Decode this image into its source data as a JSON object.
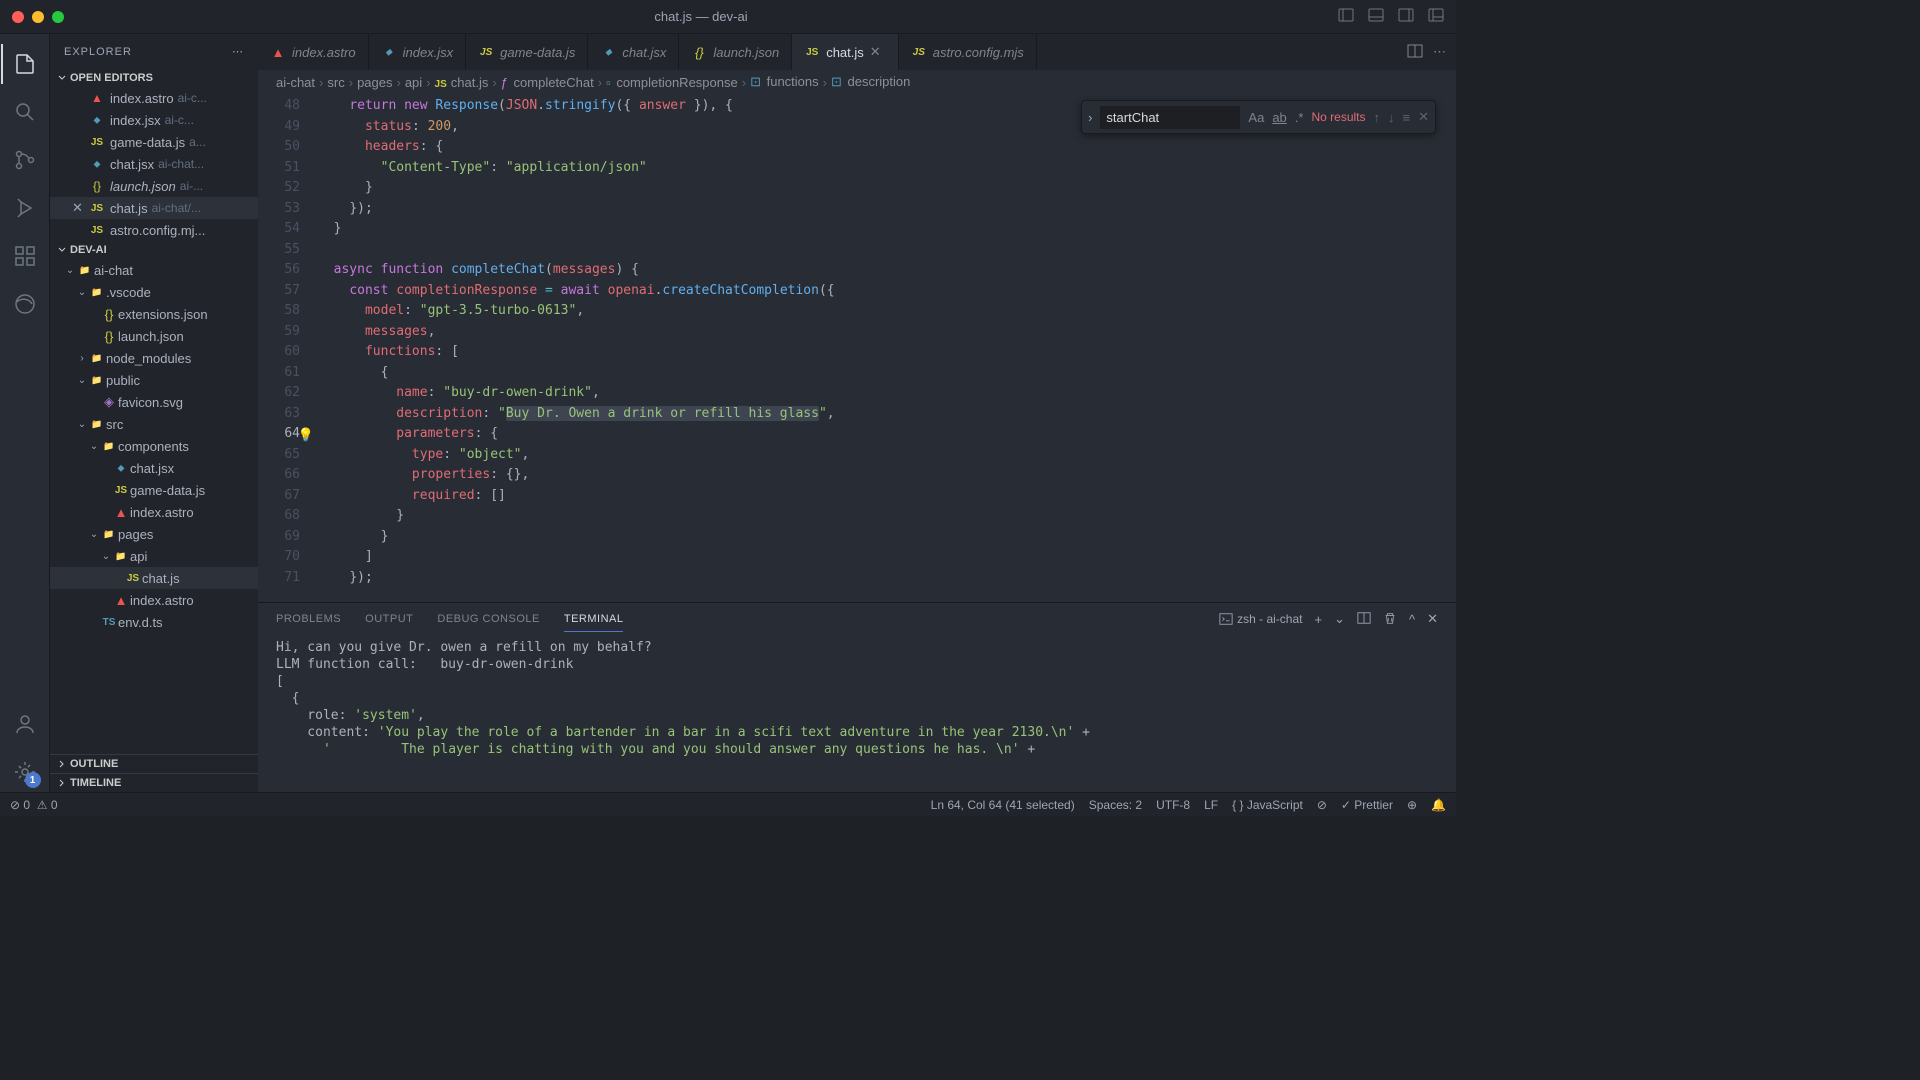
{
  "window": {
    "title": "chat.js — dev-ai"
  },
  "sidebar": {
    "header": "EXPLORER",
    "sections": {
      "openEditors": "OPEN EDITORS",
      "project": "DEV-AI",
      "outline": "OUTLINE",
      "timeline": "TIMELINE"
    },
    "openEditors": [
      {
        "label": "index.astro",
        "path": "ai-c..."
      },
      {
        "label": "index.jsx",
        "path": "ai-c..."
      },
      {
        "label": "game-data.js",
        "path": "a..."
      },
      {
        "label": "chat.jsx",
        "path": "ai-chat..."
      },
      {
        "label": "launch.json",
        "path": "ai-...",
        "italic": true
      },
      {
        "label": "chat.js",
        "path": "ai-chat/...",
        "active": true
      },
      {
        "label": "astro.config.mj...",
        "path": ""
      }
    ],
    "tree": [
      {
        "depth": 0,
        "chev": "down",
        "type": "folder",
        "label": "ai-chat"
      },
      {
        "depth": 1,
        "chev": "down",
        "type": "folder",
        "label": ".vscode"
      },
      {
        "depth": 2,
        "type": "json",
        "label": "extensions.json"
      },
      {
        "depth": 2,
        "type": "json",
        "label": "launch.json"
      },
      {
        "depth": 1,
        "chev": "right",
        "type": "folder",
        "label": "node_modules"
      },
      {
        "depth": 1,
        "chev": "down",
        "type": "folder",
        "label": "public"
      },
      {
        "depth": 2,
        "type": "svg",
        "label": "favicon.svg"
      },
      {
        "depth": 1,
        "chev": "down",
        "type": "folder",
        "label": "src"
      },
      {
        "depth": 2,
        "chev": "down",
        "type": "folder",
        "label": "components"
      },
      {
        "depth": 3,
        "type": "jsx",
        "label": "chat.jsx"
      },
      {
        "depth": 3,
        "type": "js",
        "label": "game-data.js"
      },
      {
        "depth": 3,
        "type": "astro",
        "label": "index.astro"
      },
      {
        "depth": 2,
        "chev": "down",
        "type": "folder",
        "label": "pages"
      },
      {
        "depth": 3,
        "chev": "down",
        "type": "folder",
        "label": "api"
      },
      {
        "depth": 4,
        "type": "js",
        "label": "chat.js",
        "sel": true
      },
      {
        "depth": 3,
        "type": "astro",
        "label": "index.astro"
      },
      {
        "depth": 2,
        "type": "ts",
        "label": "env.d.ts"
      }
    ]
  },
  "tabs": [
    {
      "label": "index.astro",
      "type": "astro"
    },
    {
      "label": "index.jsx",
      "type": "jsx"
    },
    {
      "label": "game-data.js",
      "type": "js"
    },
    {
      "label": "chat.jsx",
      "type": "jsx"
    },
    {
      "label": "launch.json",
      "type": "json",
      "italic": true
    },
    {
      "label": "chat.js",
      "type": "js",
      "active": true
    },
    {
      "label": "astro.config.mjs",
      "type": "js"
    }
  ],
  "breadcrumb": [
    "ai-chat",
    "src",
    "pages",
    "api",
    "chat.js",
    "completeChat",
    "completionResponse",
    "functions",
    "description"
  ],
  "find": {
    "value": "startChat",
    "results": "No results"
  },
  "code": {
    "startLine": 48,
    "lines": [
      "    <span class='k'>return</span> <span class='k'>new</span> <span class='fn'>Response</span><span class='p'>(</span><span class='v'>JSON</span><span class='p'>.</span><span class='fn'>stringify</span><span class='p'>({ </span><span class='v'>answer</span><span class='p'> }), {</span>",
      "      <span class='pr'>status</span><span class='p'>: </span><span class='c'>200</span><span class='p'>,</span>",
      "      <span class='pr'>headers</span><span class='p'>: {</span>",
      "        <span class='s'>\"Content-Type\"</span><span class='p'>: </span><span class='s'>\"application/json\"</span>",
      "      <span class='p'>}</span>",
      "    <span class='p'>});</span>",
      "  <span class='p'>}</span>",
      "",
      "  <span class='k'>async</span> <span class='k'>function</span> <span class='fn'>completeChat</span><span class='p'>(</span><span class='v'>messages</span><span class='p'>) {</span>",
      "    <span class='k'>const</span> <span class='v'>completionResponse</span> <span class='o'>=</span> <span class='k'>await</span> <span class='v'>openai</span><span class='p'>.</span><span class='fn'>createChatCompletion</span><span class='p'>({</span>",
      "      <span class='pr'>model</span><span class='p'>: </span><span class='s'>\"gpt-3.5-turbo-0613\"</span><span class='p'>,</span>",
      "      <span class='v'>messages</span><span class='p'>,</span>",
      "      <span class='pr'>functions</span><span class='p'>: [</span>",
      "        <span class='p'>{</span>",
      "          <span class='pr'>name</span><span class='p'>: </span><span class='s'>\"buy-dr-owen-drink\"</span><span class='p'>,</span>",
      "          <span class='pr'>description</span><span class='p'>: </span><span class='s'>\"<span class='sel-text'>Buy Dr. Owen a drink or refill his glass</span>\"</span><span class='p'>,</span>",
      "          <span class='pr'>parameters</span><span class='p'>: {</span>",
      "            <span class='pr'>type</span><span class='p'>: </span><span class='s'>\"object\"</span><span class='p'>,</span>",
      "            <span class='pr'>properties</span><span class='p'>: {},</span>",
      "            <span class='pr'>required</span><span class='p'>: []</span>",
      "          <span class='p'>}</span>",
      "        <span class='p'>}</span>",
      "      <span class='p'>]</span>",
      "    <span class='p'>});</span>"
    ],
    "cursorLine": 64
  },
  "panel": {
    "tabs": [
      "PROBLEMS",
      "OUTPUT",
      "DEBUG CONSOLE",
      "TERMINAL"
    ],
    "activeTab": "TERMINAL",
    "shell": "zsh - ai-chat",
    "output": "Hi, can you give Dr. owen a refill on my behalf?\nLLM function call:   buy-dr-owen-drink\n[\n  {\n    role: 'system',\n    content: 'You play the role of a bartender in a bar in a scifi text adventure in the year 2130.\\n' +\n      '         The player is chatting with you and you should answer any questions he has. \\n' +"
  },
  "status": {
    "errors": "0",
    "warnings": "0",
    "position": "Ln 64, Col 64 (41 selected)",
    "spaces": "Spaces: 2",
    "encoding": "UTF-8",
    "eol": "LF",
    "lang": "JavaScript",
    "prettier": "Prettier"
  },
  "accountBadge": "1"
}
